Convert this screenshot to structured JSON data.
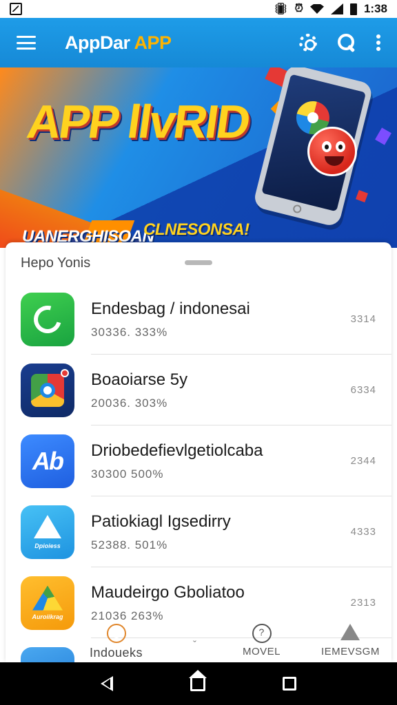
{
  "status_bar": {
    "icon_left": "image-icon",
    "icons": [
      "vibrate-icon",
      "alarm-icon",
      "wifi-icon",
      "signal-icon",
      "battery-icon"
    ],
    "time": "1:38"
  },
  "app_bar": {
    "title": "AppDar",
    "title_accent": " APP",
    "actions": [
      "gear-icon",
      "search-icon",
      "more-icon"
    ]
  },
  "banner": {
    "headline": "APP llvRID",
    "subtitle_left": "UANERGHISOAN",
    "subtitle_right": "CLNESONSA!",
    "colors": {
      "headline": "#ffd21f",
      "shadow": "#0d2f7a"
    }
  },
  "section": {
    "title": "Hepo Yonis"
  },
  "apps": [
    {
      "name": "Endesbag / indonesai",
      "meta": "30336. 333%",
      "size": "3314",
      "icon": "phone-icon"
    },
    {
      "name": "Boaoiarse 5y",
      "meta": "20036. 303%",
      "size": "6334",
      "icon": "browser-icon"
    },
    {
      "name": "Driobedefievlgetiolcaba",
      "meta": "30300 500%",
      "size": "2344",
      "icon": "ab-icon",
      "icon_text": "Ab"
    },
    {
      "name": "Patiokiagl Igsedirry",
      "meta": "52388. 501%",
      "size": "4333",
      "icon": "triangle-icon",
      "icon_caption": "Dpioiess"
    },
    {
      "name": "Maudeirgo Gboliatoo",
      "meta": "21036 263%",
      "size": "2313",
      "icon": "drive-icon",
      "icon_caption": "Auroiikrag"
    },
    {
      "name": "Indoueks",
      "meta": "",
      "size": "",
      "icon": "mountain-icon"
    }
  ],
  "bottom_nav": {
    "items": [
      {
        "label": "Indoueks",
        "icon": "home-nav-icon"
      },
      {
        "label": "ˇ",
        "icon": ""
      },
      {
        "label": "MOVEL",
        "icon": "help-icon"
      },
      {
        "label": "IEMEVSGM",
        "icon": "level-icon"
      }
    ]
  },
  "system_nav": [
    "back-icon",
    "home-icon",
    "recent-apps-icon"
  ]
}
